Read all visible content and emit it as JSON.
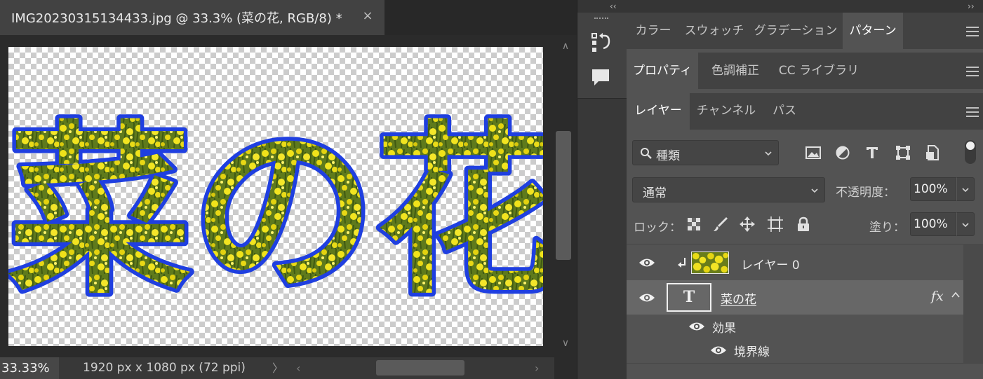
{
  "document": {
    "tab_title": "IMG20230315134433.jpg @ 33.3% (菜の花, RGB/8) *",
    "close_symbol": "×",
    "canvas_text": "菜の花"
  },
  "statusbar": {
    "zoom": "33.33%",
    "doc_info": "1920 px x 1080 px (72 ppi)",
    "arrow": "〉",
    "scroll_left": "‹",
    "scroll_right": "›"
  },
  "scrollbar": {
    "up": "∧",
    "down": "∨"
  },
  "dock": {
    "collapse": "‹‹",
    "expand": "››"
  },
  "panels": {
    "group1_tabs": [
      {
        "label": "カラー",
        "active": false
      },
      {
        "label": "スウォッチ",
        "active": false
      },
      {
        "label": "グラデーション",
        "active": false
      },
      {
        "label": "パターン",
        "active": true
      }
    ],
    "group2_tabs": [
      {
        "label": "プロパティ",
        "active": true
      },
      {
        "label": "色調補正",
        "active": false
      },
      {
        "label": "CC ライブラリ",
        "active": false
      }
    ],
    "group3_tabs": [
      {
        "label": "レイヤー",
        "active": true
      },
      {
        "label": "チャンネル",
        "active": false
      },
      {
        "label": "パス",
        "active": false
      }
    ]
  },
  "layers_panel": {
    "filter_label": "種類",
    "blend_mode": "通常",
    "opacity_label": "不透明度：",
    "opacity_value": "100%",
    "lock_label": "ロック：",
    "fill_label": "塗り：",
    "fill_value": "100%",
    "layers": [
      {
        "name": "レイヤー 0",
        "type": "image",
        "clipped": true,
        "visible": true
      },
      {
        "name": "菜の花",
        "type": "text",
        "selected": true,
        "visible": true,
        "fx": "fx"
      }
    ],
    "effects_label": "効果",
    "stroke_label": "境界線",
    "text_thumb_glyph": "T"
  },
  "colors": {
    "stroke_blue": "#1f3fe0",
    "flower_yellow": "#e8dc10",
    "panel_bg": "#535353",
    "selected_row": "#676767"
  }
}
